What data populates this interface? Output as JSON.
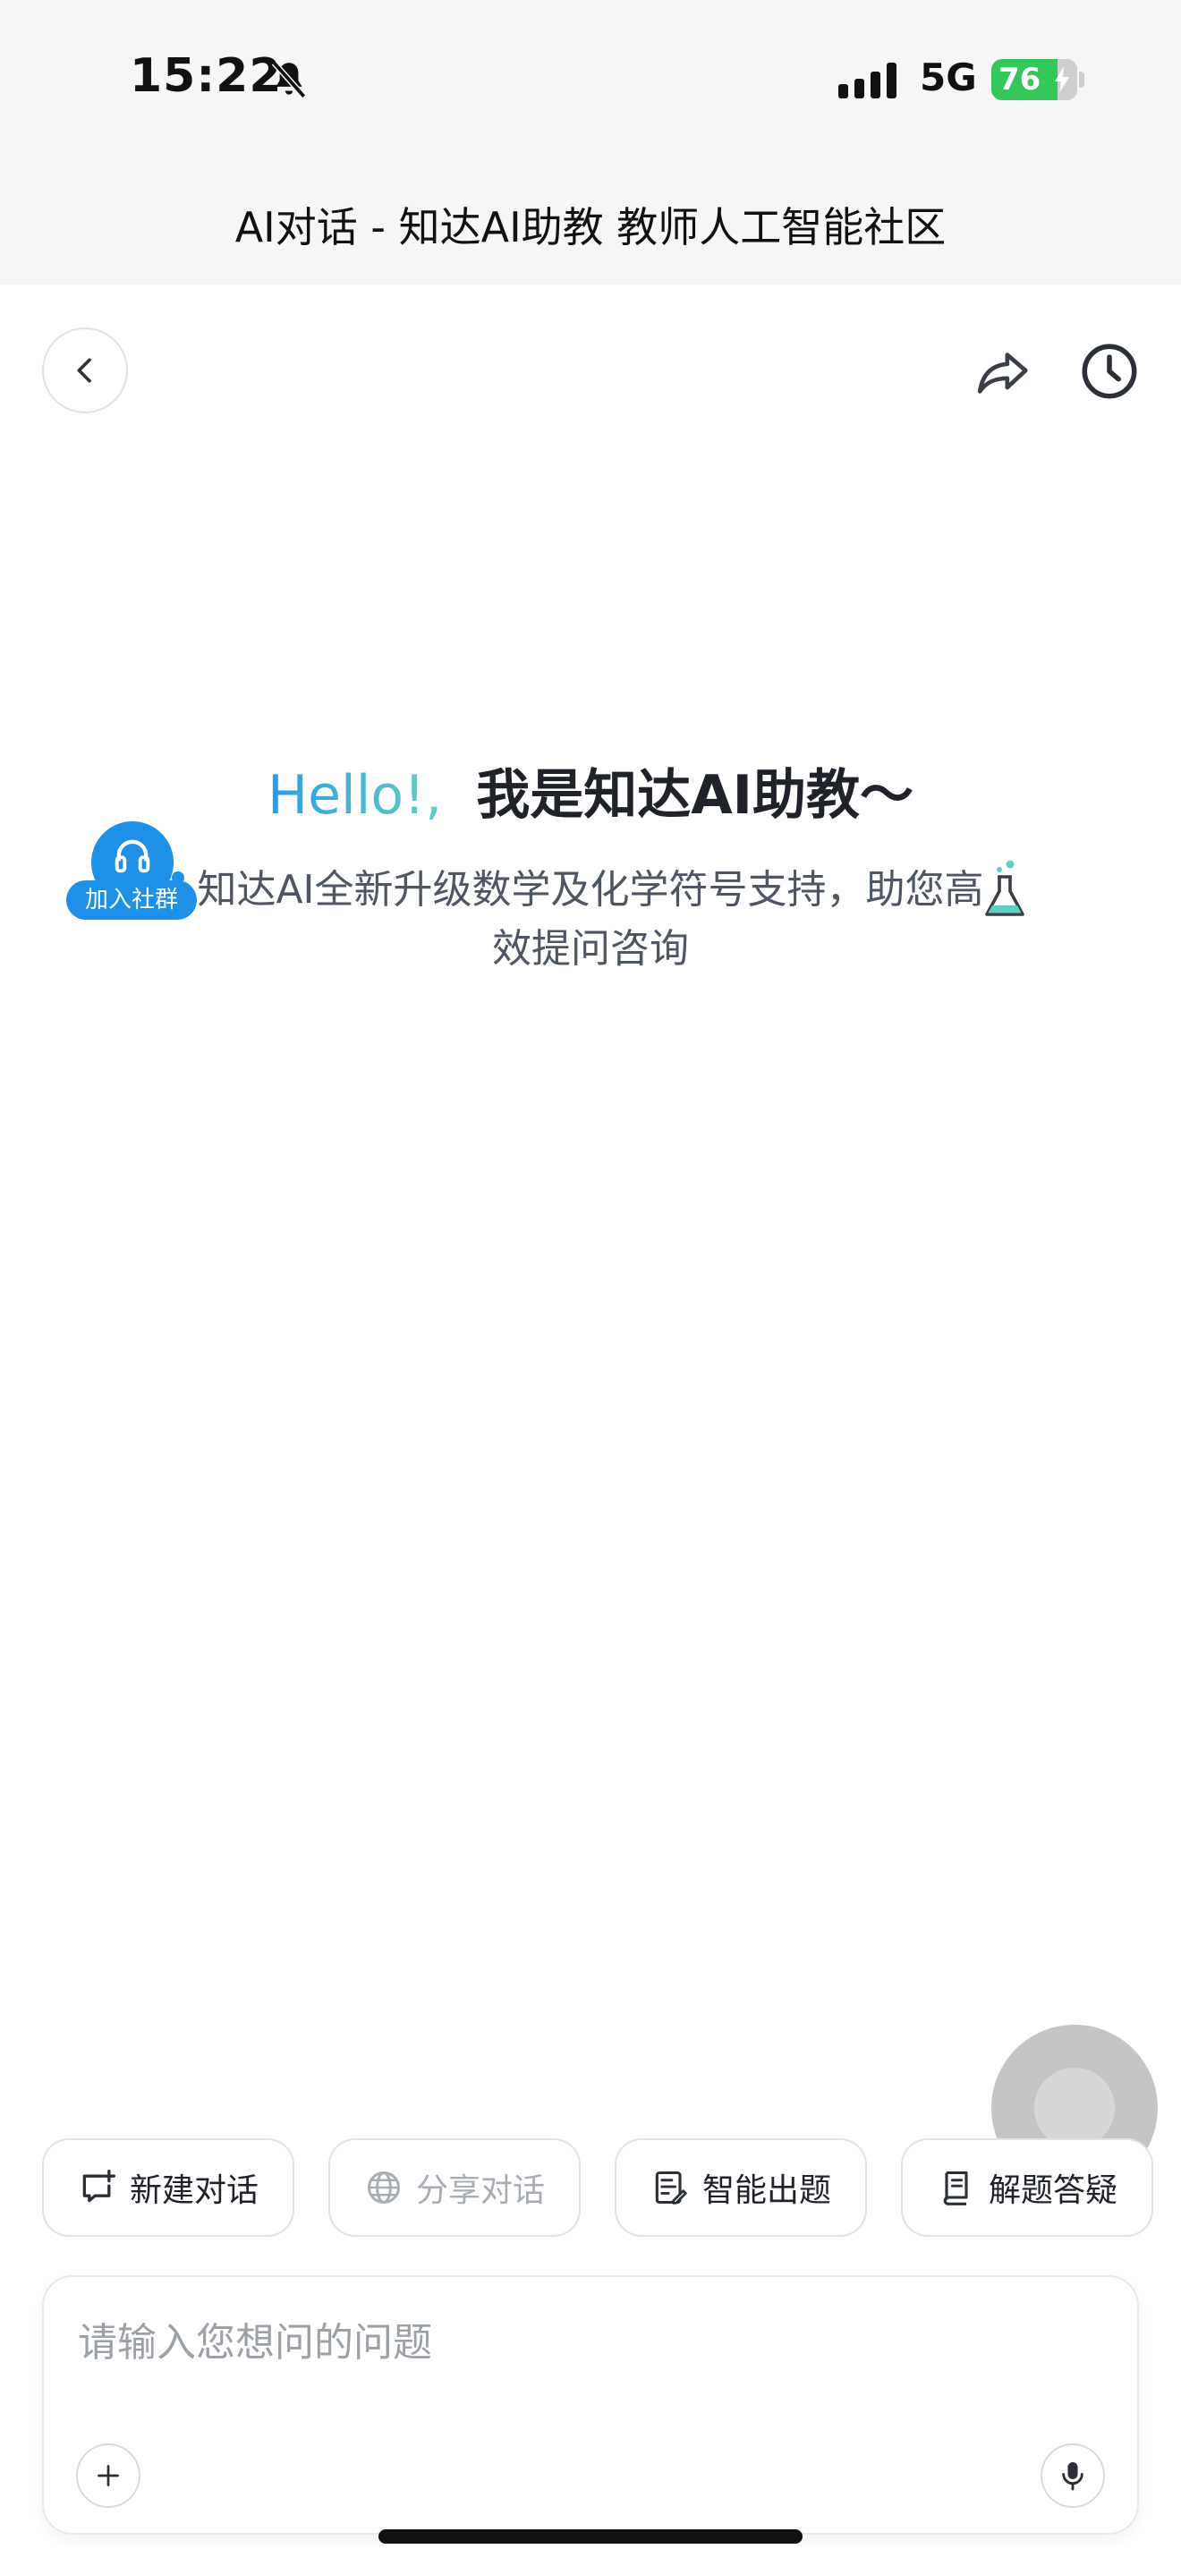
{
  "status_bar": {
    "time": "15:22",
    "network": "5G",
    "battery": "76",
    "battery_color": "#34c759",
    "icons": [
      "bell-slash-icon",
      "signal-icon",
      "charging-bolt-icon"
    ]
  },
  "header": {
    "title": "AI对话 - 知达AI助教 教师人工智能社区",
    "icons": [
      "chevron-left-icon",
      "share-icon",
      "history-clock-icon"
    ]
  },
  "hero": {
    "greeting": "Hello!,",
    "intro": "我是知达AI助教～",
    "subtitle": "知达AI全新升级数学及化学符号支持，助您高效提问咨询",
    "greeting_gradient": [
      "#2b9be6",
      "#5fd1c4"
    ],
    "icons": [
      "flask-icon"
    ]
  },
  "community_badge": {
    "label": "加入社群",
    "color": "#1e90e8",
    "icons": [
      "headset-icon"
    ]
  },
  "actions": [
    {
      "label": "新建对话",
      "icon": "new-chat-icon",
      "enabled": true
    },
    {
      "label": "分享对话",
      "icon": "globe-icon",
      "enabled": false
    },
    {
      "label": "智能出题",
      "icon": "exam-paper-icon",
      "enabled": true
    },
    {
      "label": "解题答疑",
      "icon": "notebook-icon",
      "enabled": true
    }
  ],
  "composer": {
    "placeholder": "请输入您想问的问题",
    "value": "",
    "icons": [
      "plus-icon",
      "microphone-icon"
    ]
  }
}
